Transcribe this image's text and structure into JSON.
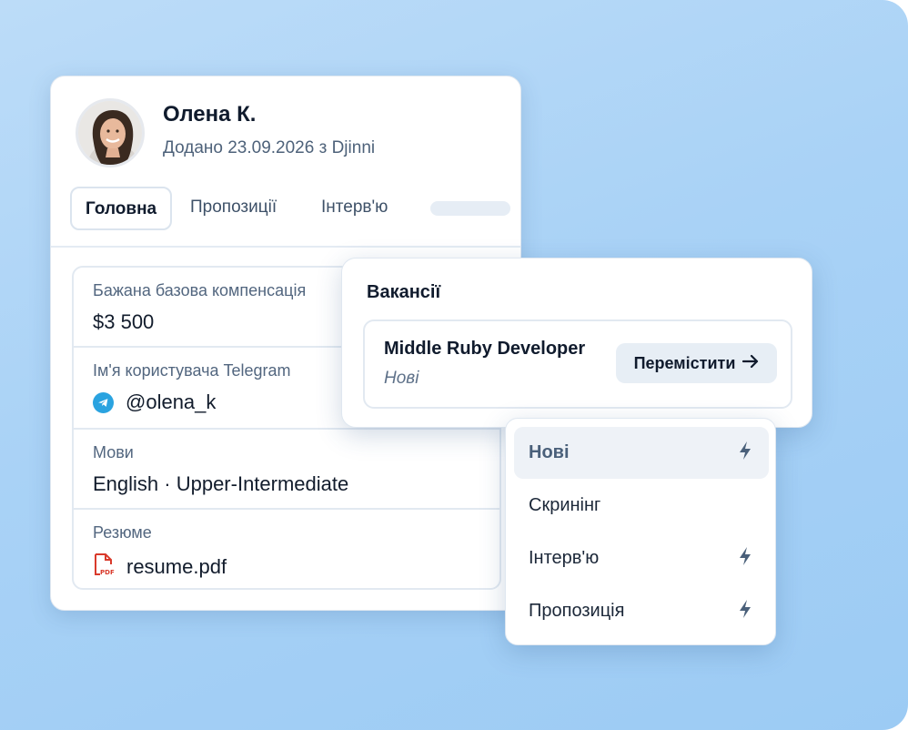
{
  "candidate": {
    "name": "Олена К.",
    "subtitle": "Додано 23.09.2026 з Djinni"
  },
  "tabs": [
    {
      "label": "Головна",
      "active": true
    },
    {
      "label": "Пропозиції",
      "active": false
    },
    {
      "label": "Інтерв'ю",
      "active": false
    }
  ],
  "fields": [
    {
      "label": "Бажана базова компенсація",
      "value": "$3 500"
    },
    {
      "label": "Ім'я користувача Telegram",
      "value": "@olena_k",
      "icon": "telegram-icon"
    },
    {
      "label": "Мови",
      "value": "English · Upper-Intermediate"
    },
    {
      "label": "Резюме",
      "value": "resume.pdf",
      "icon": "pdf-file-icon"
    }
  ],
  "vacancies": {
    "title": "Вакансії",
    "item": {
      "name": "Middle Ruby Developer",
      "stage": "Нові",
      "move_label": "Перемістити",
      "move_icon": "arrow-right-icon"
    }
  },
  "stage_menu": [
    {
      "label": "Нові",
      "selected": true,
      "automation": true
    },
    {
      "label": "Скринінг",
      "selected": false,
      "automation": false
    },
    {
      "label": "Інтерв'ю",
      "selected": false,
      "automation": true
    },
    {
      "label": "Пропозиція",
      "selected": false,
      "automation": true
    }
  ],
  "colors": {
    "background": "#a9d2f6",
    "text_primary": "#101b2d",
    "text_secondary": "#4e627a",
    "telegram": "#2aa3e0",
    "pdf": "#d93a2b",
    "bolt": "#4a607a"
  }
}
